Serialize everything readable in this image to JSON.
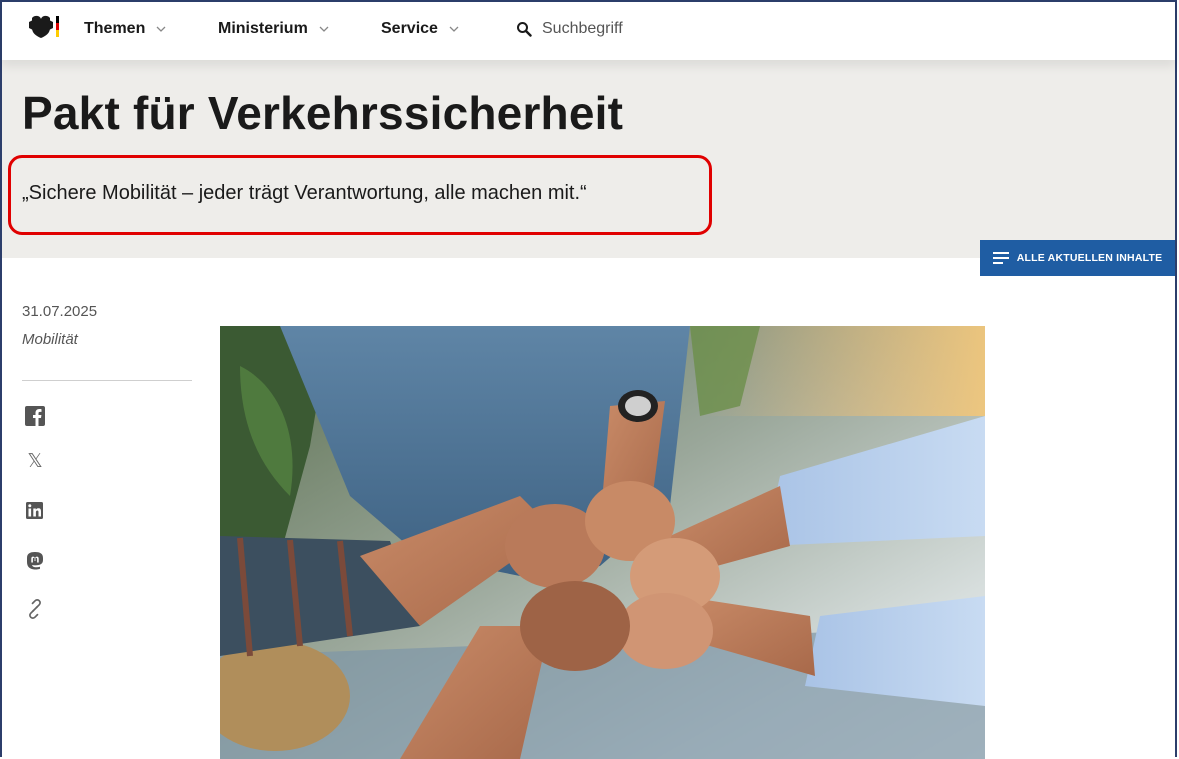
{
  "nav": {
    "items": [
      {
        "label": "Themen"
      },
      {
        "label": "Ministerium"
      },
      {
        "label": "Service"
      }
    ],
    "search_placeholder": "Suchbegriff"
  },
  "hero": {
    "title": "Pakt für Verkehrssicherheit",
    "quote": "„Sichere Mobilität – jeder trägt Verantwortung, alle machen mit.“"
  },
  "all_content_button": "ALLE AKTUELLEN INHALTE",
  "article": {
    "date": "31.07.2025",
    "category": "Mobilität"
  },
  "share": {
    "x_glyph": "𝕏"
  },
  "colors": {
    "accent_blue": "#1f5da3",
    "highlight_red": "#e00000",
    "hero_bg": "#eeedea"
  }
}
